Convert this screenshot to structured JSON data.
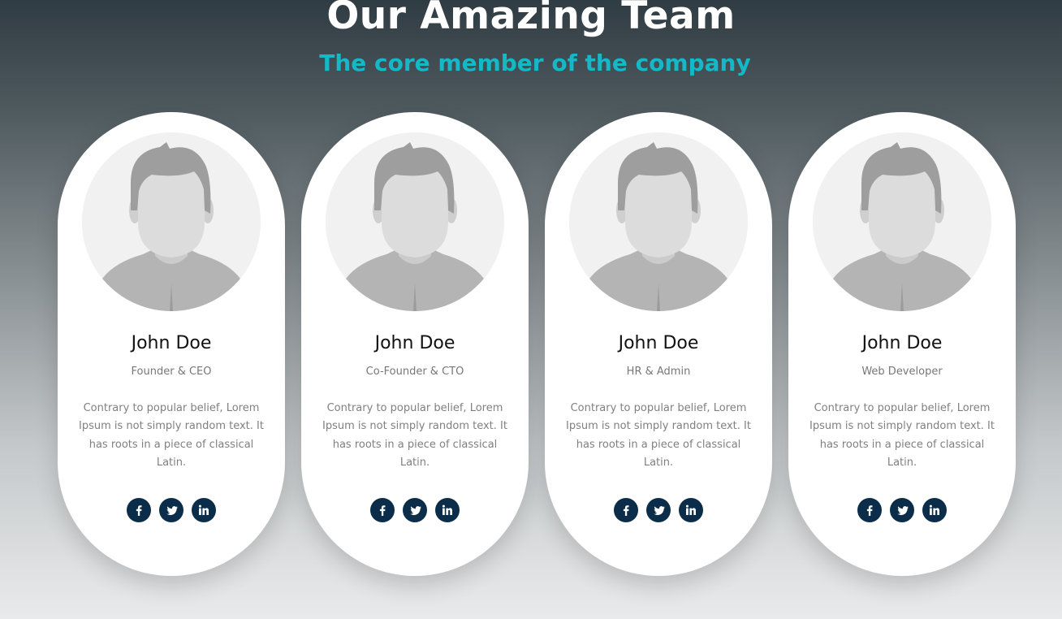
{
  "header": {
    "title": "Our Amazing Team",
    "subtitle": "The core member of the company"
  },
  "colors": {
    "accent": "#14b8c6",
    "social_bg": "#0b2d4a",
    "card_bg": "#ffffff"
  },
  "members": [
    {
      "name": "John Doe",
      "role": "Founder & CEO",
      "description": "Contrary to popular belief, Lorem Ipsum is not simply random text. It has roots in a piece of classical Latin.",
      "avatar_icon": "user-avatar-placeholder-icon",
      "socials": [
        "facebook-icon",
        "twitter-icon",
        "linkedin-icon"
      ]
    },
    {
      "name": "John Doe",
      "role": "Co-Founder & CTO",
      "description": "Contrary to popular belief, Lorem Ipsum is not simply random text. It has roots in a piece of classical Latin.",
      "avatar_icon": "user-avatar-placeholder-icon",
      "socials": [
        "facebook-icon",
        "twitter-icon",
        "linkedin-icon"
      ]
    },
    {
      "name": "John Doe",
      "role": "HR & Admin",
      "description": "Contrary to popular belief, Lorem Ipsum is not simply random text. It has roots in a piece of classical Latin.",
      "avatar_icon": "user-avatar-placeholder-icon",
      "socials": [
        "facebook-icon",
        "twitter-icon",
        "linkedin-icon"
      ]
    },
    {
      "name": "John Doe",
      "role": "Web Developer",
      "description": "Contrary to popular belief, Lorem Ipsum is not simply random text. It has roots in a piece of classical Latin.",
      "avatar_icon": "user-avatar-placeholder-icon",
      "socials": [
        "facebook-icon",
        "twitter-icon",
        "linkedin-icon"
      ]
    }
  ]
}
